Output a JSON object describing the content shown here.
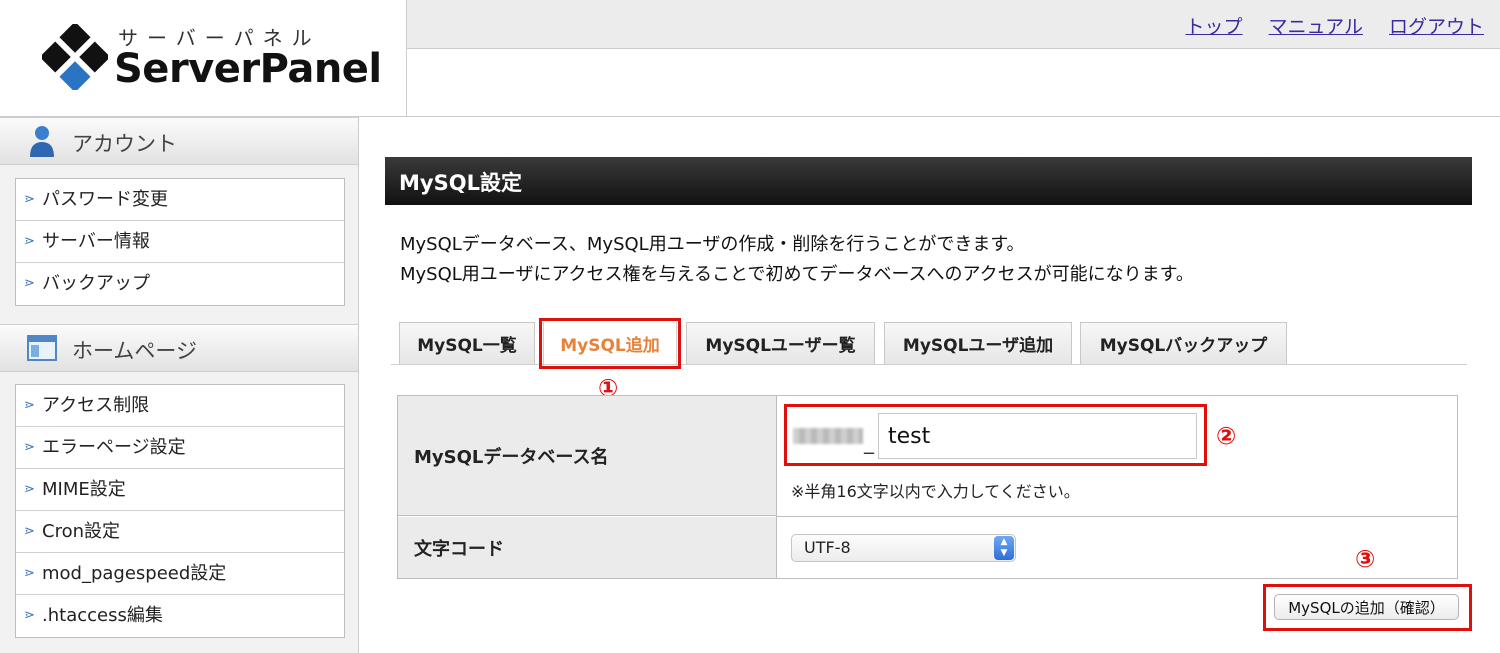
{
  "logo": {
    "kana": "サーバーパネル",
    "name": "ServerPanel"
  },
  "header": {
    "links": [
      "トップ",
      "マニュアル",
      "ログアウト"
    ]
  },
  "sidebar": {
    "sections": [
      {
        "title": "アカウント",
        "icon": "user-icon",
        "items": [
          "パスワード変更",
          "サーバー情報",
          "バックアップ"
        ]
      },
      {
        "title": "ホームページ",
        "icon": "window-icon",
        "items": [
          "アクセス制限",
          "エラーページ設定",
          "MIME設定",
          "Cron設定",
          "mod_pagespeed設定",
          ".htaccess編集"
        ]
      }
    ]
  },
  "main": {
    "title": "MySQL設定",
    "description": [
      "MySQLデータベース、MySQL用ユーザの作成・削除を行うことができます。",
      "MySQL用ユーザにアクセス権を与えることで初めてデータベースへのアクセスが可能になります。"
    ],
    "tabs": [
      "MySQL一覧",
      "MySQL追加",
      "MySQLユーザー覧",
      "MySQLユーザ追加",
      "MySQLバックアップ"
    ],
    "active_tab": "MySQL追加",
    "form": {
      "db_name_label": "MySQLデータベース名",
      "db_name_separator": "_",
      "db_name_value": "test",
      "db_name_note": "※半角16文字以内で入力してください。",
      "charset_label": "文字コード",
      "charset_value": "UTF-8"
    },
    "submit_label": "MySQLの追加（確認）"
  },
  "annotations": [
    "①",
    "②",
    "③"
  ],
  "colors": {
    "highlight": "#e10e0e",
    "active_tab_text": "#e8823a",
    "link": "#3a2aa0"
  }
}
